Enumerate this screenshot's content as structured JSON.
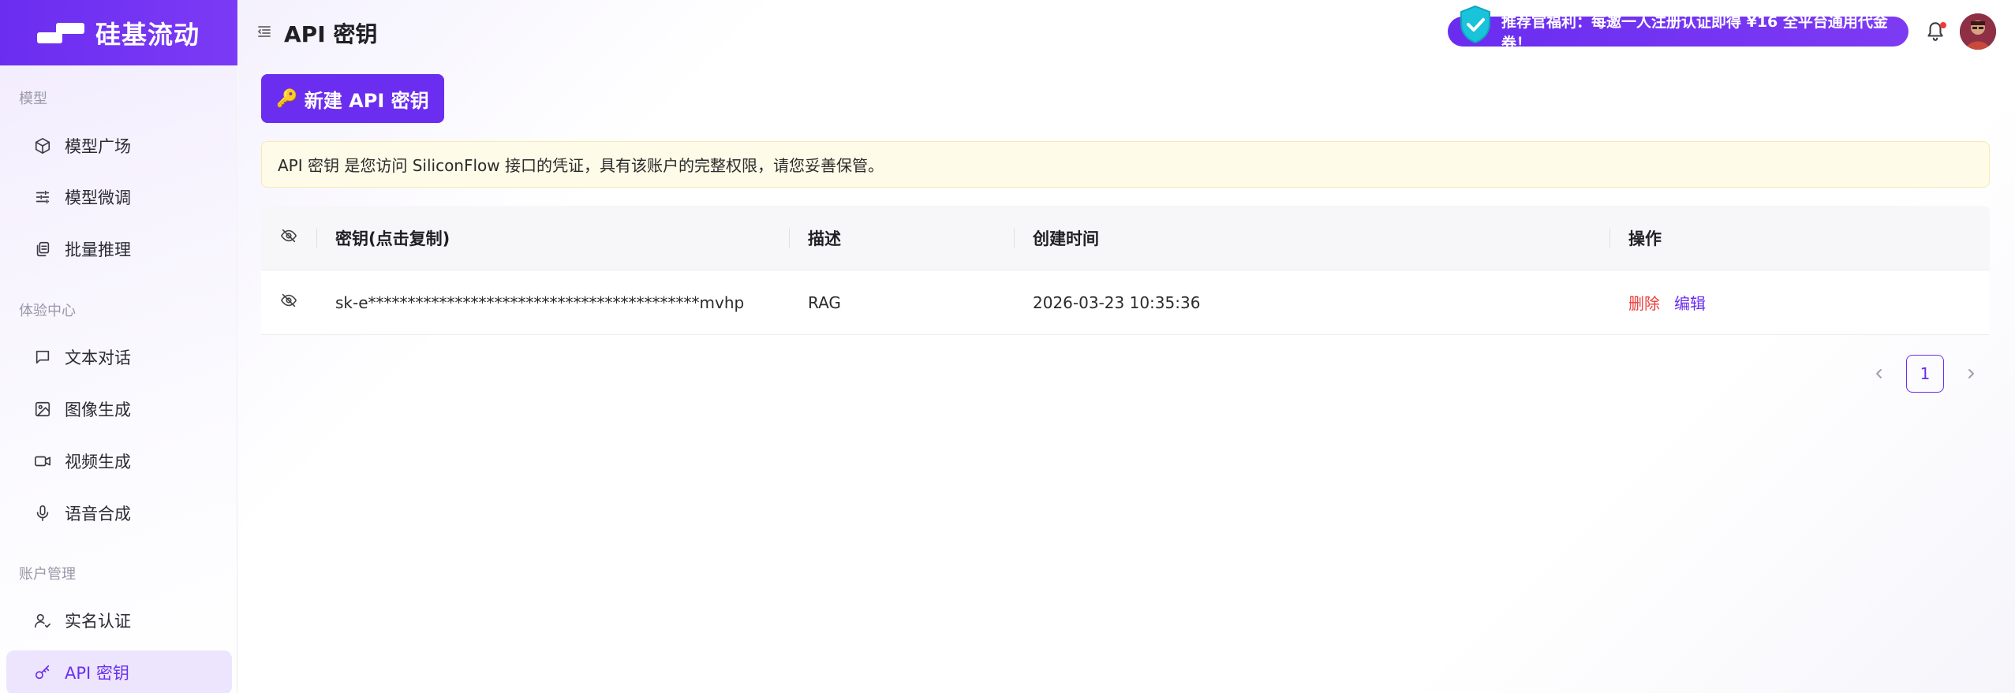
{
  "brand": {
    "name": "硅基流动"
  },
  "sidebar": {
    "groups": [
      {
        "label": "模型"
      },
      {
        "label": "体验中心"
      },
      {
        "label": "账户管理"
      }
    ],
    "items": [
      {
        "label": "模型广场",
        "icon": "cube-icon"
      },
      {
        "label": "模型微调",
        "icon": "sliders-icon"
      },
      {
        "label": "批量推理",
        "icon": "copy-icon"
      },
      {
        "label": "文本对话",
        "icon": "chat-icon"
      },
      {
        "label": "图像生成",
        "icon": "image-icon"
      },
      {
        "label": "视频生成",
        "icon": "video-icon"
      },
      {
        "label": "语音合成",
        "icon": "microphone-icon"
      },
      {
        "label": "实名认证",
        "icon": "user-check-icon"
      },
      {
        "label": "API 密钥",
        "icon": "key-icon",
        "active": true
      }
    ]
  },
  "header": {
    "title": "API 密钥",
    "promo": "推荐官福利：每邀一人注册认证即得 ¥16 全平台通用代金券！"
  },
  "actions": {
    "new_key": "新建 API 密钥"
  },
  "notice": "API 密钥 是您访问 SiliconFlow 接口的凭证，具有该账户的完整权限，请您妥善保管。",
  "table": {
    "columns": [
      "密钥(点击复制)",
      "描述",
      "创建时间",
      "操作"
    ],
    "rows": [
      {
        "key": "sk-e******************************************mvhp",
        "description": "RAG",
        "created": "2026-03-23 10:35:36",
        "delete": "删除",
        "edit": "编辑"
      }
    ]
  },
  "pagination": {
    "current": "1"
  },
  "colors": {
    "accent": "#6b2df0",
    "danger": "#ee3b3b",
    "notice_bg": "#fefbe8"
  }
}
